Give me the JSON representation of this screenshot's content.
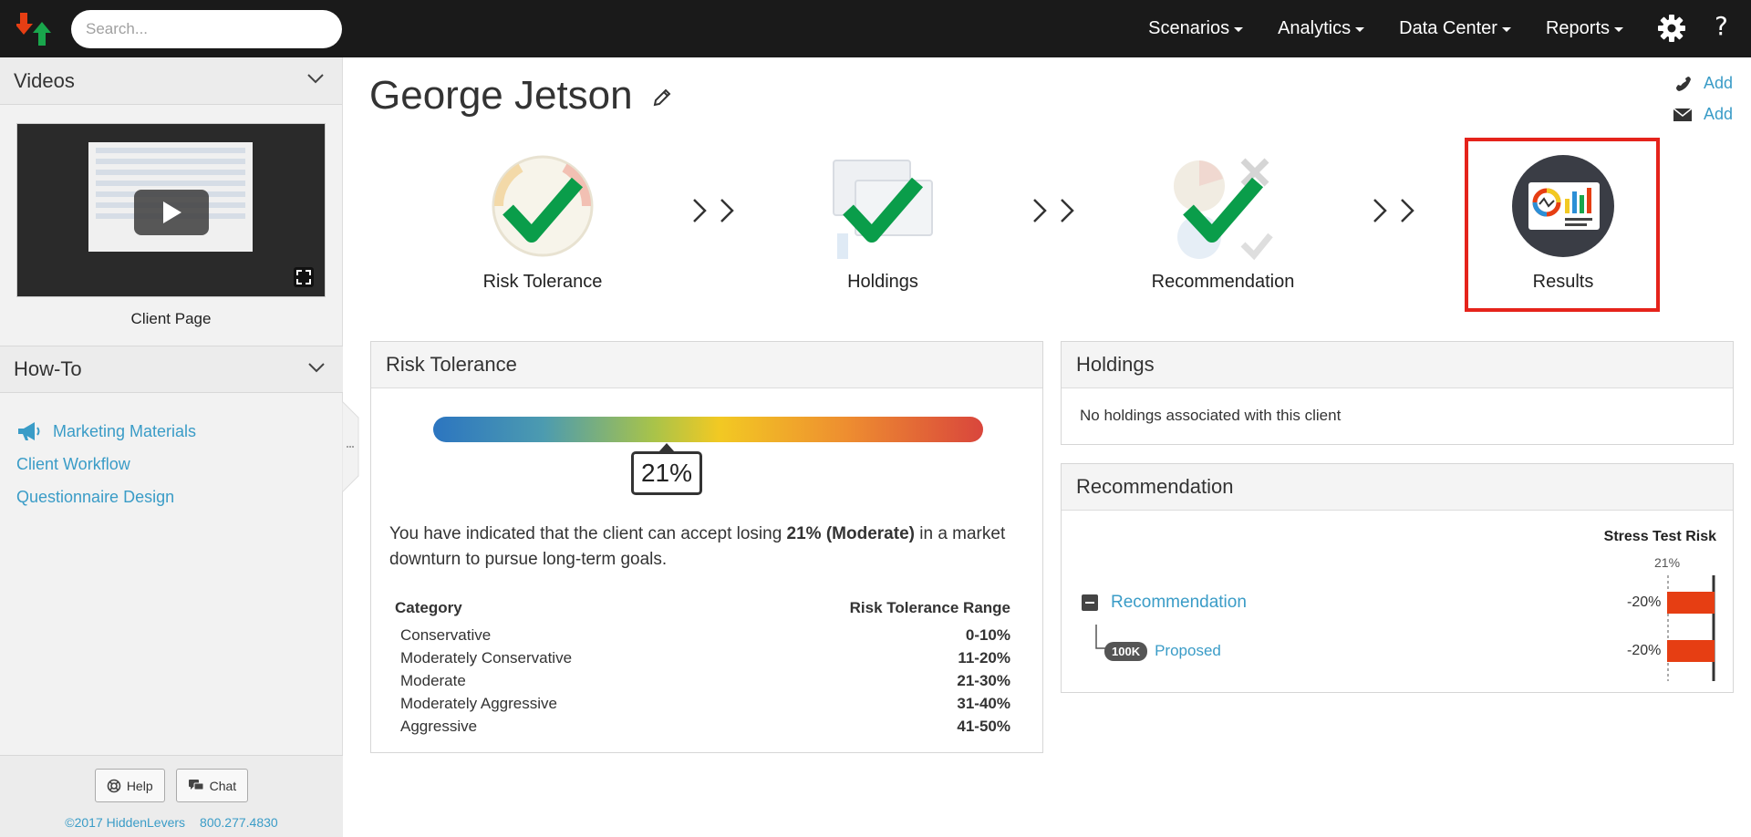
{
  "search": {
    "placeholder": "Search..."
  },
  "nav": {
    "items": [
      {
        "label": "Scenarios"
      },
      {
        "label": "Analytics"
      },
      {
        "label": "Data Center"
      },
      {
        "label": "Reports"
      }
    ],
    "help": "?"
  },
  "sidebar": {
    "videos_title": "Videos",
    "video_caption": "Client Page",
    "howto_title": "How-To",
    "howto_links": [
      "Marketing Materials",
      "Client Workflow",
      "Questionnaire Design"
    ],
    "help_button": "Help",
    "chat_button": "Chat",
    "copyright": "©2017 HiddenLevers",
    "phone": "800.277.4830"
  },
  "client": {
    "name": "George Jetson",
    "phone_add": "Add",
    "email_add": "Add"
  },
  "steps": [
    {
      "label": "Risk Tolerance",
      "done": true
    },
    {
      "label": "Holdings",
      "done": true
    },
    {
      "label": "Recommendation",
      "done": true
    },
    {
      "label": "Results",
      "done": false,
      "selected": true
    }
  ],
  "risk_panel": {
    "title": "Risk Tolerance",
    "value_pct": 21,
    "value_label": "21%",
    "text_pre": "You have indicated that the client can accept losing ",
    "text_bold": "21% (Moderate)",
    "text_post": " in a market downturn to pursue long-term goals.",
    "col_category": "Category",
    "col_range": "Risk Tolerance Range",
    "rows": [
      {
        "category": "Conservative",
        "range": "0-10%"
      },
      {
        "category": "Moderately Conservative",
        "range": "11-20%"
      },
      {
        "category": "Moderate",
        "range": "21-30%"
      },
      {
        "category": "Moderately Aggressive",
        "range": "31-40%"
      },
      {
        "category": "Aggressive",
        "range": "41-50%"
      }
    ]
  },
  "holdings_panel": {
    "title": "Holdings",
    "empty_text": "No holdings associated with this client"
  },
  "rec_panel": {
    "title": "Recommendation",
    "col_header": "Stress Test Risk",
    "threshold_label": "21%",
    "rows": [
      {
        "label": "Recommendation",
        "value": "-20%",
        "value_num": -20
      },
      {
        "badge": "100K",
        "label": "Proposed",
        "value": "-20%",
        "value_num": -20
      }
    ]
  },
  "colors": {
    "accent": "#3a9cc7",
    "check": "#0a9d4a",
    "bar": "#e63e13",
    "highlight": "#e5231b"
  }
}
